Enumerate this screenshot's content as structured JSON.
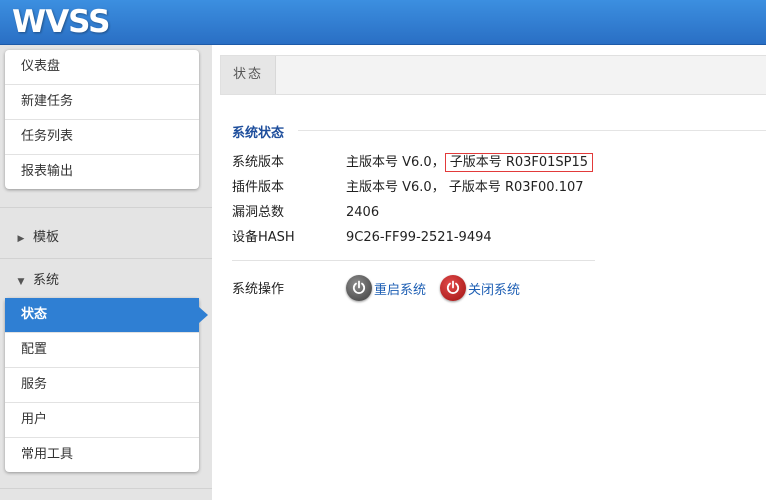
{
  "app": {
    "logo": "WVSS"
  },
  "sidebar": {
    "top_items": [
      {
        "label": "仪表盘"
      },
      {
        "label": "新建任务"
      },
      {
        "label": "任务列表"
      },
      {
        "label": "报表输出"
      }
    ],
    "groups": [
      {
        "label": "模板",
        "expanded": false
      },
      {
        "label": "系统",
        "expanded": true
      }
    ],
    "system_items": [
      {
        "label": "状态",
        "active": true
      },
      {
        "label": "配置"
      },
      {
        "label": "服务"
      },
      {
        "label": "用户"
      },
      {
        "label": "常用工具"
      }
    ]
  },
  "main": {
    "tab": "状态",
    "section_title": "系统状态",
    "rows": [
      {
        "label": "系统版本",
        "value_a": "主版本号 V6.0，",
        "value_b": "子版本号 R03F01SP15"
      },
      {
        "label": "插件版本",
        "value": "主版本号 V6.0， 子版本号 R03F00.107"
      },
      {
        "label": "漏洞总数",
        "value": "2406"
      },
      {
        "label": "设备HASH",
        "value": "9C26-FF99-2521-9494"
      }
    ],
    "operations": {
      "label": "系统操作",
      "restart": "重启系统",
      "shutdown": "关闭系统"
    }
  },
  "colors": {
    "header": "#2a6fc4",
    "active_item": "#2f7fd3",
    "link": "#1e5fb4",
    "highlight_border": "#e23a3a",
    "section_title": "#1e4e9c"
  },
  "icons": {
    "restart": "power-icon",
    "shutdown": "power-icon",
    "collapsed": "triangle-right-icon",
    "expanded": "triangle-down-icon"
  }
}
